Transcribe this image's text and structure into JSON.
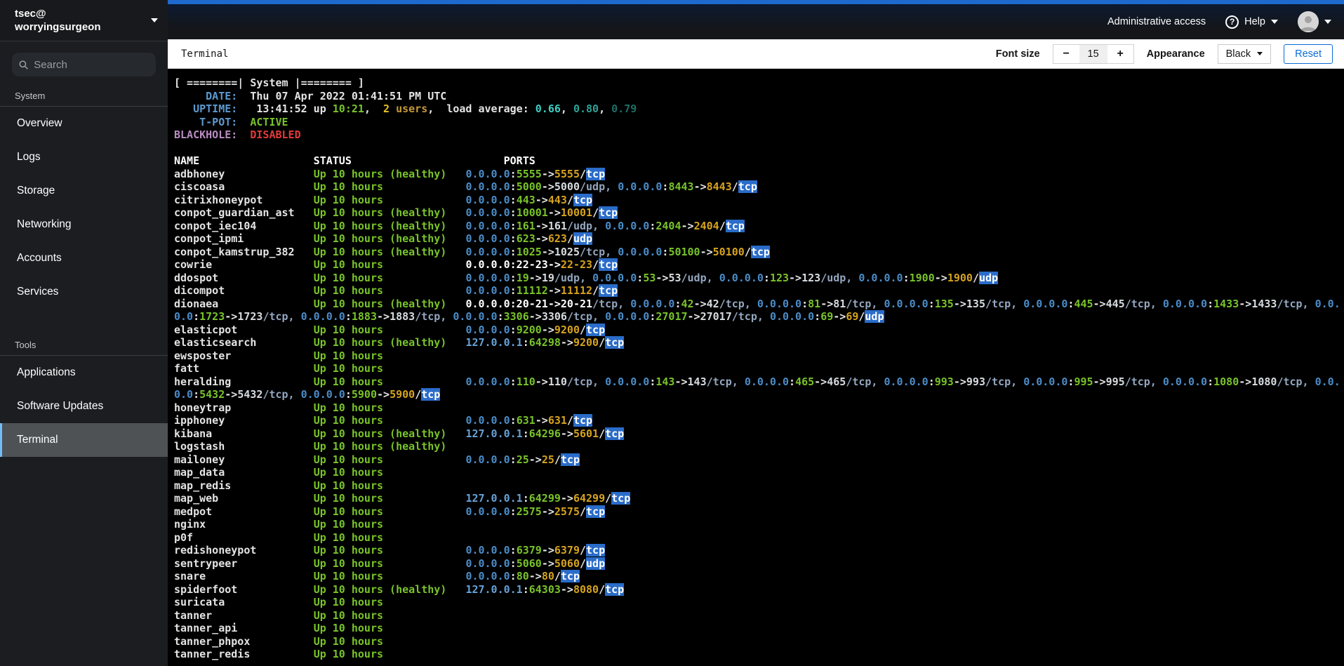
{
  "masthead": {
    "host_user": "tsec@",
    "host_name": "worryingsurgeon",
    "admin_access_label": "Administrative access",
    "help_label": "Help",
    "icons": {
      "help_glyph": "?"
    }
  },
  "sidebar": {
    "search_placeholder": "Search",
    "sections": [
      {
        "label": "System",
        "items": [
          {
            "label": "Overview"
          },
          {
            "label": "Logs"
          },
          {
            "label": "Storage"
          },
          {
            "label": "Networking"
          },
          {
            "label": "Accounts"
          },
          {
            "label": "Services"
          }
        ]
      },
      {
        "label": "Tools",
        "items": [
          {
            "label": "Applications"
          },
          {
            "label": "Software Updates"
          },
          {
            "label": "Terminal"
          }
        ]
      }
    ],
    "selected_item": "Terminal"
  },
  "page_header": {
    "title": "Terminal",
    "font_size_label": "Font size",
    "decrease_label": "−",
    "font_size": "15",
    "increase_label": "+",
    "appearance_label": "Appearance",
    "appearance_value": "Black",
    "reset_label": "Reset"
  },
  "terminal": {
    "info_lines": [
      [
        {
          "t": "[ ========| System |======== ]",
          "c": "w"
        }
      ],
      [
        {
          "t": "     DATE:",
          "c": "lbl"
        },
        {
          "t": "  Thu 07 Apr 2022 01:41:51 PM UTC",
          "c": "w"
        }
      ],
      [
        {
          "t": "   UPTIME:",
          "c": "lbl"
        },
        {
          "t": "   13:41:52 up ",
          "c": "w"
        },
        {
          "t": "10:21",
          "c": "grn"
        },
        {
          "t": ",  ",
          "c": "w"
        },
        {
          "t": "2",
          "c": "yel"
        },
        {
          "t": " users",
          "c": "yel2"
        },
        {
          "t": ",  load average: ",
          "c": "w"
        },
        {
          "t": "0.66",
          "c": "cy1"
        },
        {
          "t": ", ",
          "c": "w"
        },
        {
          "t": "0.80",
          "c": "cy2"
        },
        {
          "t": ", ",
          "c": "w"
        },
        {
          "t": "0.79",
          "c": "cy3"
        }
      ],
      [
        {
          "t": "    T-POT:",
          "c": "lbl"
        },
        {
          "t": "  ",
          "c": "w"
        },
        {
          "t": "ACTIVE",
          "c": "grn"
        }
      ],
      [
        {
          "t": "BLACKHOLE:",
          "c": "pl"
        },
        {
          "t": "  ",
          "c": "w"
        },
        {
          "t": "DISABLED",
          "c": "red"
        }
      ]
    ],
    "table_header": {
      "name": "NAME",
      "status": "STATUS",
      "ports": "PORTS"
    },
    "columns": {
      "name_width": 22,
      "status_width": 24,
      "header_status_width": 30,
      "terminal_cols": 184
    },
    "containers": [
      {
        "name": "adbhoney",
        "status": "Up 10 hours (healthy)",
        "ports": "0.0.0.0:5555->5555/tcp"
      },
      {
        "name": "ciscoasa",
        "status": "Up 10 hours",
        "ports": "0.0.0.0:5000->5000/udp, 0.0.0.0:8443->8443/tcp"
      },
      {
        "name": "citrixhoneypot",
        "status": "Up 10 hours",
        "ports": "0.0.0.0:443->443/tcp"
      },
      {
        "name": "conpot_guardian_ast",
        "status": "Up 10 hours (healthy)",
        "ports": "0.0.0.0:10001->10001/tcp"
      },
      {
        "name": "conpot_iec104",
        "status": "Up 10 hours (healthy)",
        "ports": "0.0.0.0:161->161/udp, 0.0.0.0:2404->2404/tcp"
      },
      {
        "name": "conpot_ipmi",
        "status": "Up 10 hours (healthy)",
        "ports": "0.0.0.0:623->623/udp"
      },
      {
        "name": "conpot_kamstrup_382",
        "status": "Up 10 hours (healthy)",
        "ports": "0.0.0.0:1025->1025/tcp, 0.0.0.0:50100->50100/tcp"
      },
      {
        "name": "cowrie",
        "status": "Up 10 hours",
        "ports": "0.0.0.0:22-23->22-23/tcp"
      },
      {
        "name": "ddospot",
        "status": "Up 10 hours",
        "ports": "0.0.0.0:19->19/udp, 0.0.0.0:53->53/udp, 0.0.0.0:123->123/udp, 0.0.0.0:1900->1900/udp"
      },
      {
        "name": "dicompot",
        "status": "Up 10 hours",
        "ports": "0.0.0.0:11112->11112/tcp"
      },
      {
        "name": "dionaea",
        "status": "Up 10 hours (healthy)",
        "ports": "0.0.0.0:20-21->20-21/tcp, 0.0.0.0:42->42/tcp, 0.0.0.0:81->81/tcp, 0.0.0.0:135->135/tcp, 0.0.0.0:445->445/tcp, 0.0.0.0:1433->1433/tcp, 0.0.0.0:1723->1723/tcp, 0.0.0.0:1883->1883/tcp, 0.0.0.0:3306->3306/tcp, 0.0.0.0:27017->27017/tcp, 0.0.0.0:69->69/udp"
      },
      {
        "name": "elasticpot",
        "status": "Up 10 hours",
        "ports": "0.0.0.0:9200->9200/tcp"
      },
      {
        "name": "elasticsearch",
        "status": "Up 10 hours (healthy)",
        "ports": "127.0.0.1:64298->9200/tcp"
      },
      {
        "name": "ewsposter",
        "status": "Up 10 hours",
        "ports": ""
      },
      {
        "name": "fatt",
        "status": "Up 10 hours",
        "ports": ""
      },
      {
        "name": "heralding",
        "status": "Up 10 hours",
        "ports": "0.0.0.0:110->110/tcp, 0.0.0.0:143->143/tcp, 0.0.0.0:465->465/tcp, 0.0.0.0:993->993/tcp, 0.0.0.0:995->995/tcp, 0.0.0.0:1080->1080/tcp, 0.0.0.0:5432->5432/tcp, 0.0.0.0:5900->5900/tcp"
      },
      {
        "name": "honeytrap",
        "status": "Up 10 hours",
        "ports": ""
      },
      {
        "name": "ipphoney",
        "status": "Up 10 hours",
        "ports": "0.0.0.0:631->631/tcp"
      },
      {
        "name": "kibana",
        "status": "Up 10 hours (healthy)",
        "ports": "127.0.0.1:64296->5601/tcp"
      },
      {
        "name": "logstash",
        "status": "Up 10 hours (healthy)",
        "ports": ""
      },
      {
        "name": "mailoney",
        "status": "Up 10 hours",
        "ports": "0.0.0.0:25->25/tcp"
      },
      {
        "name": "map_data",
        "status": "Up 10 hours",
        "ports": ""
      },
      {
        "name": "map_redis",
        "status": "Up 10 hours",
        "ports": ""
      },
      {
        "name": "map_web",
        "status": "Up 10 hours",
        "ports": "127.0.0.1:64299->64299/tcp"
      },
      {
        "name": "medpot",
        "status": "Up 10 hours",
        "ports": "0.0.0.0:2575->2575/tcp"
      },
      {
        "name": "nginx",
        "status": "Up 10 hours",
        "ports": ""
      },
      {
        "name": "p0f",
        "status": "Up 10 hours",
        "ports": ""
      },
      {
        "name": "redishoneypot",
        "status": "Up 10 hours",
        "ports": "0.0.0.0:6379->6379/tcp"
      },
      {
        "name": "sentrypeer",
        "status": "Up 10 hours",
        "ports": "0.0.0.0:5060->5060/udp"
      },
      {
        "name": "snare",
        "status": "Up 10 hours",
        "ports": "0.0.0.0:80->80/tcp"
      },
      {
        "name": "spiderfoot",
        "status": "Up 10 hours (healthy)",
        "ports": "127.0.0.1:64303->8080/tcp"
      },
      {
        "name": "suricata",
        "status": "Up 10 hours",
        "ports": ""
      },
      {
        "name": "tanner",
        "status": "Up 10 hours",
        "ports": ""
      },
      {
        "name": "tanner_api",
        "status": "Up 10 hours",
        "ports": ""
      },
      {
        "name": "tanner_phpox",
        "status": "Up 10 hours",
        "ports": ""
      },
      {
        "name": "tanner_redis",
        "status": "Up 10 hours",
        "ports": ""
      }
    ]
  }
}
